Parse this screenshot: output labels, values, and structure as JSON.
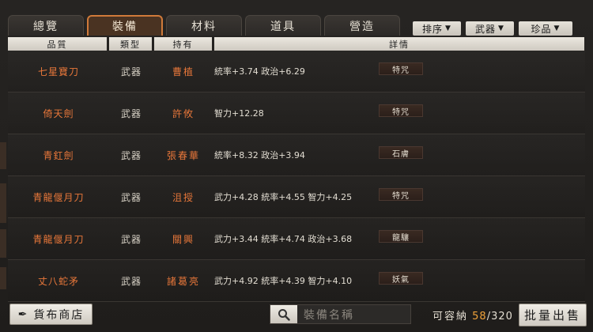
{
  "tabs": [
    {
      "label": "總覽"
    },
    {
      "label": "裝備",
      "active": true
    },
    {
      "label": "材料"
    },
    {
      "label": "道具"
    },
    {
      "label": "營造"
    }
  ],
  "filters": [
    {
      "label": "排序"
    },
    {
      "label": "武器"
    },
    {
      "label": "珍品"
    }
  ],
  "columns": {
    "quality": "品質",
    "type": "類型",
    "holder": "持有",
    "detail": "詳情"
  },
  "rows": [
    {
      "name": "七星寶刀",
      "type": "武器",
      "holder": "曹植",
      "detail": "統率+3.74  政治+6.29",
      "tag": "特咒"
    },
    {
      "name": "倚天劍",
      "type": "武器",
      "holder": "許攸",
      "detail": "智力+12.28",
      "tag": "特咒"
    },
    {
      "name": "青釭劍",
      "type": "武器",
      "holder": "張春華",
      "detail": "統率+8.32  政治+3.94",
      "tag": "石膚"
    },
    {
      "name": "青龍偃月刀",
      "type": "武器",
      "holder": "沮授",
      "detail": "武力+4.28  統率+4.55  智力+4.25",
      "tag": "特咒"
    },
    {
      "name": "青龍偃月刀",
      "type": "武器",
      "holder": "關興",
      "detail": "武力+3.44  統率+4.74  政治+3.68",
      "tag": "龍驤"
    },
    {
      "name": "丈八蛇矛",
      "type": "武器",
      "holder": "諸葛亮",
      "detail": "武力+4.92  統率+4.39  智力+4.10",
      "tag": "妖氣"
    }
  ],
  "bottom": {
    "shop_label": "貨布商店",
    "search_placeholder": "裝備名稱",
    "capacity_label": "可容納",
    "capacity_current": "58",
    "capacity_sep": "/",
    "capacity_total": "320",
    "sell_label": "批量出售"
  },
  "colors": {
    "accent": "#e8773a",
    "capacity_current": "#f0a23a"
  }
}
